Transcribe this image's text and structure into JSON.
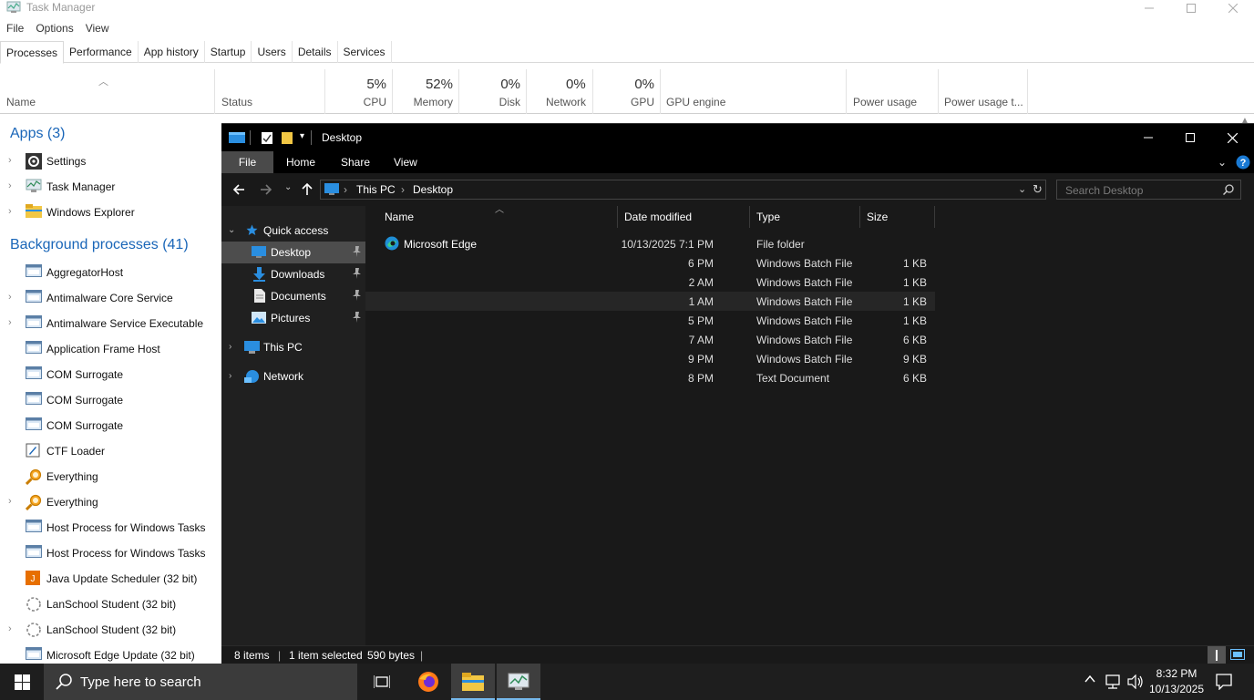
{
  "task_manager": {
    "title": "Task Manager",
    "menu": [
      "File",
      "Options",
      "View"
    ],
    "tabs": [
      "Processes",
      "Performance",
      "App history",
      "Startup",
      "Users",
      "Details",
      "Services"
    ],
    "active_tab": "Processes",
    "columns": {
      "name": "Name",
      "status": "Status",
      "cpu": {
        "pct": "5%",
        "label": "CPU"
      },
      "memory": {
        "pct": "52%",
        "label": "Memory"
      },
      "disk": {
        "pct": "0%",
        "label": "Disk"
      },
      "network": {
        "pct": "0%",
        "label": "Network"
      },
      "gpu": {
        "pct": "0%",
        "label": "GPU"
      },
      "gpu_engine": "GPU engine",
      "power_usage": "Power usage",
      "power_usage_trend": "Power usage t..."
    },
    "apps_header": "Apps (3)",
    "apps": [
      {
        "name": "Settings",
        "icon": "gear-icon",
        "expandable": true
      },
      {
        "name": "Task Manager",
        "icon": "task-manager-icon",
        "expandable": true
      },
      {
        "name": "Windows Explorer",
        "icon": "folder-icon",
        "expandable": true
      }
    ],
    "bg_header": "Background processes (41)",
    "bg_processes": [
      {
        "name": "AggregatorHost",
        "icon": "window-icon",
        "expandable": false
      },
      {
        "name": "Antimalware Core Service",
        "icon": "window-icon",
        "expandable": true
      },
      {
        "name": "Antimalware Service Executable",
        "icon": "window-icon",
        "expandable": true
      },
      {
        "name": "Application Frame Host",
        "icon": "window-icon",
        "expandable": false
      },
      {
        "name": "COM Surrogate",
        "icon": "window-icon",
        "expandable": false
      },
      {
        "name": "COM Surrogate",
        "icon": "window-icon",
        "expandable": false
      },
      {
        "name": "COM Surrogate",
        "icon": "window-icon",
        "expandable": false
      },
      {
        "name": "CTF Loader",
        "icon": "ctf-icon",
        "expandable": false
      },
      {
        "name": "Everything",
        "icon": "search-magnifier-icon",
        "expandable": false
      },
      {
        "name": "Everything",
        "icon": "search-magnifier-icon",
        "expandable": true
      },
      {
        "name": "Host Process for Windows Tasks",
        "icon": "window-icon",
        "expandable": false
      },
      {
        "name": "Host Process for Windows Tasks",
        "icon": "window-icon",
        "expandable": false
      },
      {
        "name": "Java Update Scheduler (32 bit)",
        "icon": "java-icon",
        "expandable": false
      },
      {
        "name": "LanSchool Student (32 bit)",
        "icon": "lanschool-icon",
        "expandable": false
      },
      {
        "name": "LanSchool Student (32 bit)",
        "icon": "lanschool-icon",
        "expandable": true
      },
      {
        "name": "Microsoft Edge Update (32 bit)",
        "icon": "window-icon",
        "expandable": false
      }
    ]
  },
  "explorer": {
    "title": "Desktop",
    "ribbon_tabs": [
      "File",
      "Home",
      "Share",
      "View"
    ],
    "breadcrumb": [
      "This PC",
      "Desktop"
    ],
    "search_placeholder": "Search Desktop",
    "sidebar": {
      "quick_access": "Quick access",
      "items": [
        "Desktop",
        "Downloads",
        "Documents",
        "Pictures"
      ],
      "this_pc": "This PC",
      "network": "Network"
    },
    "columns": [
      "Name",
      "Date modified",
      "Type",
      "Size"
    ],
    "files": [
      {
        "name": "Microsoft Edge",
        "date": "10/13/2025 7:1 PM",
        "type": "File folder",
        "size": ""
      },
      {
        "name": "",
        "date": "6 PM",
        "type": "Windows Batch File",
        "size": "1 KB"
      },
      {
        "name": "",
        "date": "2 AM",
        "type": "Windows Batch File",
        "size": "1 KB"
      },
      {
        "name": "",
        "date": "1 AM",
        "type": "Windows Batch File",
        "size": "1 KB"
      },
      {
        "name": "",
        "date": "5 PM",
        "type": "Windows Batch File",
        "size": "1 KB"
      },
      {
        "name": "",
        "date": "7 AM",
        "type": "Windows Batch File",
        "size": "6 KB"
      },
      {
        "name": "",
        "date": "9 PM",
        "type": "Windows Batch File",
        "size": "9 KB"
      },
      {
        "name": "",
        "date": "8 PM",
        "type": "Text Document",
        "size": "6 KB"
      }
    ],
    "status": {
      "items": "8 items",
      "selected": "1 item selected",
      "bytes": "590 bytes"
    }
  },
  "taskbar": {
    "search_placeholder": "Type here to search",
    "time": "8:32 PM",
    "date": "10/13/2025"
  },
  "colors": {
    "accent_blue": "#1a66b8",
    "explorer_bg": "#191919",
    "taskbar_bg": "#1e1e1e"
  }
}
